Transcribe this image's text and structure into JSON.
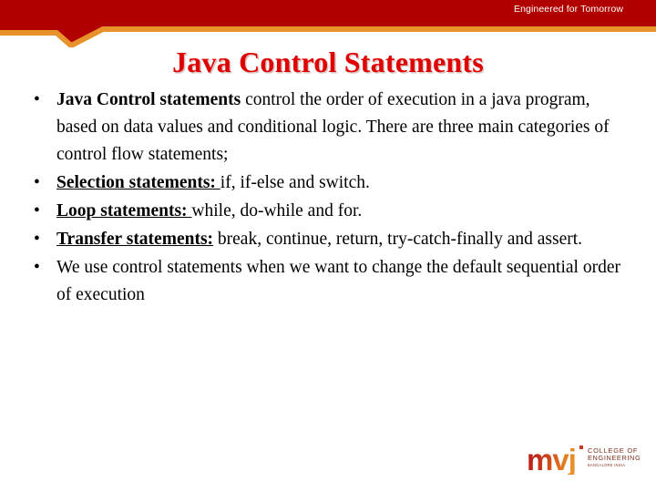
{
  "header": {
    "tagline": "Engineered for Tomorrow",
    "band_color": "#B00000",
    "accent_color": "#E8922B"
  },
  "title": {
    "text": "Java Control Statements",
    "color": "#E00000"
  },
  "body": {
    "bullet_glyph": "•",
    "bullets": [
      {
        "lead": "Java Control statements",
        "lead_style": "bold",
        "rest": " control the order of execution in a java program, based on data values and conditional logic. There are three main categories of control flow statements;"
      },
      {
        "lead": "Selection statements: ",
        "lead_style": "bold-underline",
        "rest": "if, if-else and switch."
      },
      {
        "lead": "Loop statements: ",
        "lead_style": "bold-underline",
        "rest": "while, do-while and for."
      },
      {
        "lead": "Transfer statements:",
        "lead_style": "bold-underline",
        "rest": " break, continue, return, try-catch-finally and assert."
      },
      {
        "lead": "",
        "lead_style": "none",
        "rest": "We use control statements when we want to change the default sequential order of execution"
      }
    ]
  },
  "logo": {
    "mark": "mvj",
    "line1": "COLLEGE OF",
    "line2": "ENGINEERING",
    "line3": "BANGALORE INDIA",
    "color_start": "#B81818",
    "color_end": "#EB9A2C"
  }
}
